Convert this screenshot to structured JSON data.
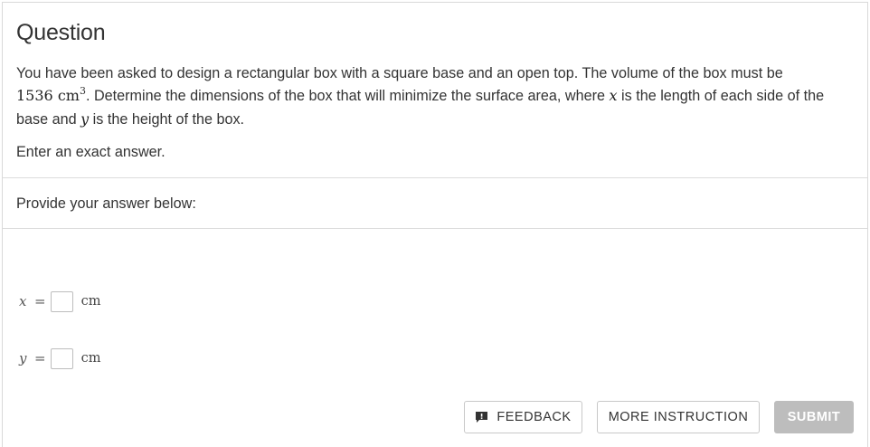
{
  "question": {
    "title": "Question",
    "text_part1": "You have been asked to design a rectangular box with a square base and an open top. The volume of the box must be",
    "volume_value": "1536",
    "volume_unit": "cm",
    "volume_exponent": "3",
    "text_part2": ". Determine the dimensions of the box that will minimize the surface area, where",
    "var_x": "x",
    "text_part3": "is the length of each side of the base and",
    "var_y": "y",
    "text_part4": "is the height of the box.",
    "instruction": "Enter an exact answer."
  },
  "answer_section": {
    "label": "Provide your answer below:",
    "fields": [
      {
        "variable": "x",
        "equals": "=",
        "unit": "cm",
        "value": ""
      },
      {
        "variable": "y",
        "equals": "=",
        "unit": "cm",
        "value": ""
      }
    ]
  },
  "buttons": {
    "feedback": "FEEDBACK",
    "feedback_icon": "feedback-icon",
    "more_instruction": "MORE INSTRUCTION",
    "submit": "SUBMIT"
  },
  "colors": {
    "submit_bg": "#bdbdbd",
    "border": "#d9d9d9",
    "text": "#333333"
  }
}
